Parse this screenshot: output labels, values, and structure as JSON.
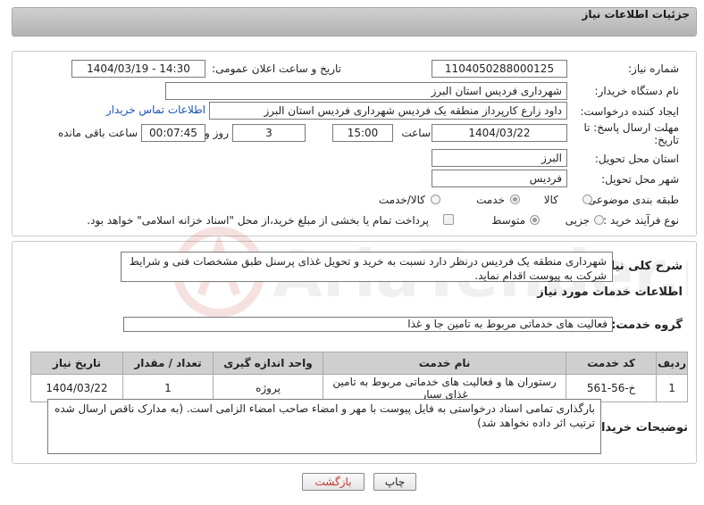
{
  "header": {
    "title": "جزئیات اطلاعات نیاز"
  },
  "form": {
    "need_number": {
      "label": "شماره نیاز:",
      "value": "1104050288000125"
    },
    "announce_datetime": {
      "label": "تاریخ و ساعت اعلان عمومی:",
      "value": "1404/03/19 - 14:30"
    },
    "buyer_org": {
      "label": "نام دستگاه خریدار:",
      "value": "شهرداری فردیس استان البرز"
    },
    "requester": {
      "label": "ایجاد کننده درخواست:",
      "value": "داود زارع کارپرداز منطقه یک فردیس شهرداری فردیس استان البرز"
    },
    "buyer_contact_link": "اطلاعات تماس خریدار",
    "deadline": {
      "label_line1": "مهلت ارسال پاسخ: تا",
      "label_line2": "تاریخ:",
      "date": "1404/03/22",
      "time_label": "ساعت",
      "time": "15:00",
      "days": "3",
      "days_label": "روز و",
      "remaining": "00:07:45",
      "remaining_label": "ساعت باقی مانده"
    },
    "province": {
      "label": "استان محل تحویل:",
      "value": "البرز"
    },
    "city": {
      "label": "شهر محل تحویل:",
      "value": "فردیس"
    },
    "category": {
      "label": "طبقه بندی موضوعی:",
      "options": [
        "کالا",
        "خدمت",
        "کالا/خدمت"
      ],
      "selected": "خدمت"
    },
    "purchase_type": {
      "label": "نوع فرآیند خرید :",
      "options": [
        "جزیی",
        "متوسط"
      ],
      "selected": "متوسط",
      "treasury_note": "پرداخت تمام یا بخشی از مبلغ خرید،از محل \"اسناد خزانه اسلامی\" خواهد بود."
    }
  },
  "summary": {
    "label": "شرح کلی نیاز:",
    "text": "شهرداری منطقه یک فردیس درنظر دارد نسبت به خرید و تحویل غذای پرسنل طبق مشخصات فنی و شرایط شرکت به پیوست اقدام نماید."
  },
  "services": {
    "section_title": "اطلاعات خدمات مورد نیاز",
    "group_label": "گروه خدمت:",
    "group_value": "فعالیت های خدماتی مربوط به تامین جا و غذا",
    "columns": [
      "ردیف",
      "کد خدمت",
      "نام خدمت",
      "واحد اندازه گیری",
      "تعداد / مقدار",
      "تاریخ نیاز"
    ],
    "rows": [
      {
        "index": "1",
        "code": "خ-56-561",
        "name": "رستوران ها و فعالیت های خدماتی مربوط به تامین غذای سیار",
        "unit": "پروژه",
        "qty": "1",
        "date": "1404/03/22"
      }
    ]
  },
  "buyer_notes": {
    "label": "توضیحات خریدار:",
    "text": "بارگذاری تمامی اسناد درخواستی به فایل پیوست با مهر و امضاء صاحب امضاء الزامی است. (به مدارک ناقص ارسال شده ترتیب اثر داده نخواهد شد)"
  },
  "buttons": {
    "print": "چاپ",
    "back": "بازگشت"
  },
  "watermark": {
    "text": "AriaTender.net"
  },
  "colors": {
    "link": "#1a55b0",
    "header_bg": "#c4c4c4",
    "back_btn_text": "#c0392b"
  }
}
